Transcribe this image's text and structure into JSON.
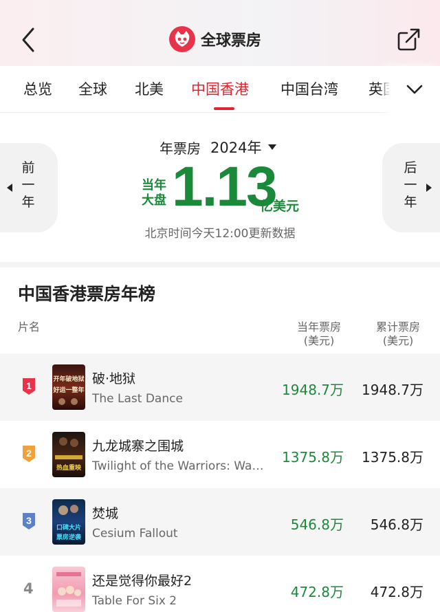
{
  "header": {
    "title": "全球票房",
    "back_icon": "chevron-left-icon",
    "share_icon": "share-icon",
    "logo_icon": "cat-logo-icon"
  },
  "tabs": {
    "items": [
      "总览",
      "全球",
      "北美",
      "中国香港",
      "中国台湾",
      "英国"
    ],
    "active_index": 3,
    "more_icon": "chevron-down-icon"
  },
  "summary": {
    "period_label": "年票房",
    "period_value": "2024年",
    "prev_label": "前一年",
    "next_label": "后一年",
    "total_label": "当年大盘",
    "total_value": "1.13",
    "total_unit": "亿美元",
    "update_note": "北京时间今天12:00更新数据"
  },
  "ranking": {
    "title": "中国香港票房年榜",
    "columns": {
      "name": "片名",
      "current": "当年票房",
      "current_unit": "(美元)",
      "total": "累计票房",
      "total_unit": "(美元)"
    },
    "rows": [
      {
        "rank": "1",
        "title_cn": "破·地狱",
        "title_en": "The Last Dance",
        "current": "1948.7万",
        "total": "1948.7万",
        "poster_text": "开年破地狱 好运一整年"
      },
      {
        "rank": "2",
        "title_cn": "九龙城寨之围城",
        "title_en": "Twilight of the Warriors: Walled In",
        "current": "1375.8万",
        "total": "1375.8万",
        "poster_text": "热血重映"
      },
      {
        "rank": "3",
        "title_cn": "焚城",
        "title_en": "Cesium Fallout",
        "current": "546.8万",
        "total": "546.8万",
        "poster_text": "口碑大片 票房逆袭"
      },
      {
        "rank": "4",
        "title_cn": "还是觉得你最好2",
        "title_en": "Table For Six 2",
        "current": "472.8万",
        "total": "472.8万",
        "poster_text": ""
      }
    ]
  },
  "colors": {
    "accent_red": "#e1242f",
    "money_green": "#1a8a3a",
    "badge_red": "#e8344a",
    "badge_orange": "#f0a13c",
    "badge_blue": "#5b82c9"
  }
}
